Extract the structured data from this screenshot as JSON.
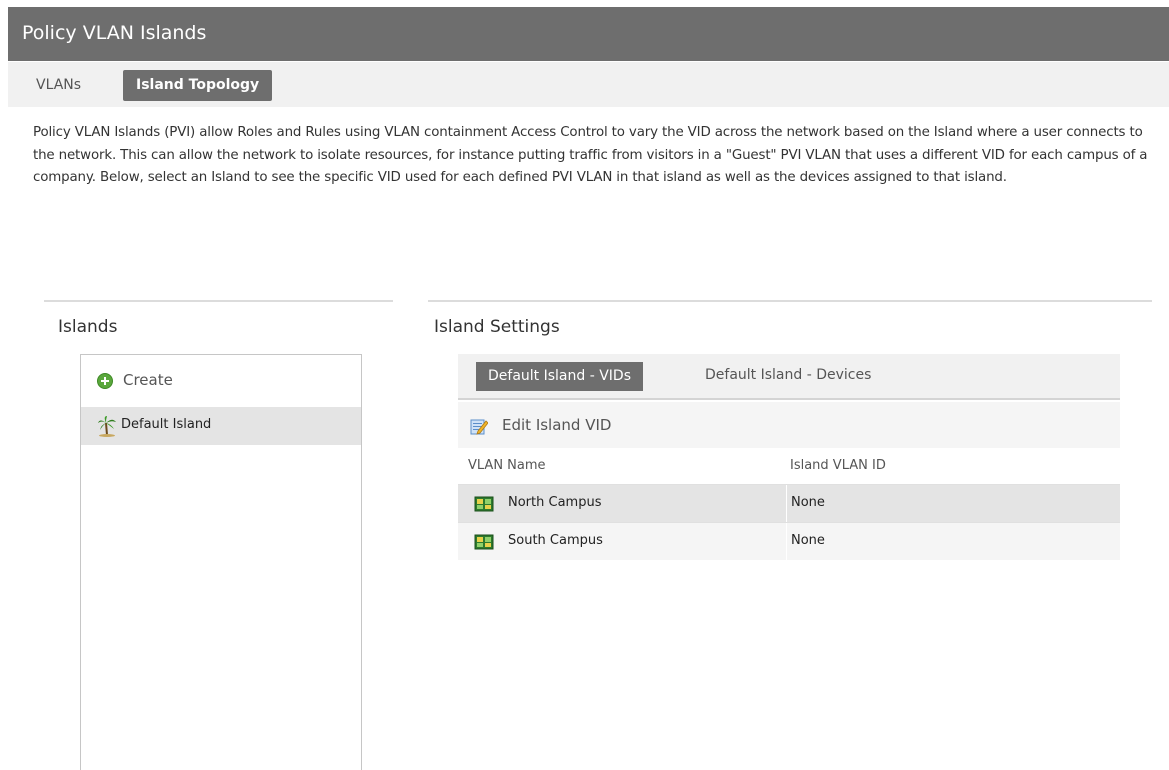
{
  "window": {
    "title": "Policy VLAN Islands"
  },
  "tabs": [
    {
      "label": "VLANs",
      "active": false
    },
    {
      "label": "Island Topology",
      "active": true
    }
  ],
  "description": "Policy VLAN Islands (PVI) allow Roles and Rules using VLAN containment Access Control to vary the VID across the network based on the Island where a user connects to the network. This can allow the network to isolate resources, for instance putting traffic from visitors in a \"Guest\" PVI VLAN that uses a different VID for each campus of a company. Below, select an Island to see the specific VID used for each defined PVI VLAN in that island as well as the devices assigned to that island.",
  "islands": {
    "heading": "Islands",
    "create_label": "Create",
    "items": [
      {
        "label": "Default Island",
        "icon": "palm-tree-icon",
        "selected": true
      }
    ]
  },
  "settings": {
    "heading": "Island Settings",
    "subtabs": [
      {
        "label": "Default Island - VIDs",
        "active": true
      },
      {
        "label": "Default Island - Devices",
        "active": false
      }
    ],
    "toolbar": {
      "edit_label": "Edit Island VID",
      "icon": "edit-icon"
    },
    "columns": [
      "VLAN Name",
      "Island VLAN ID"
    ],
    "rows": [
      {
        "name": "North Campus",
        "vid": "None",
        "icon": "vlan-icon",
        "selected": true
      },
      {
        "name": "South Campus",
        "vid": "None",
        "icon": "vlan-icon",
        "selected": false
      }
    ]
  },
  "colors": {
    "title_bar": "#6e6e6e",
    "active_tab": "#6e6e6e",
    "selected_row": "#e4e4e4",
    "create_icon": "#5aa73c"
  }
}
